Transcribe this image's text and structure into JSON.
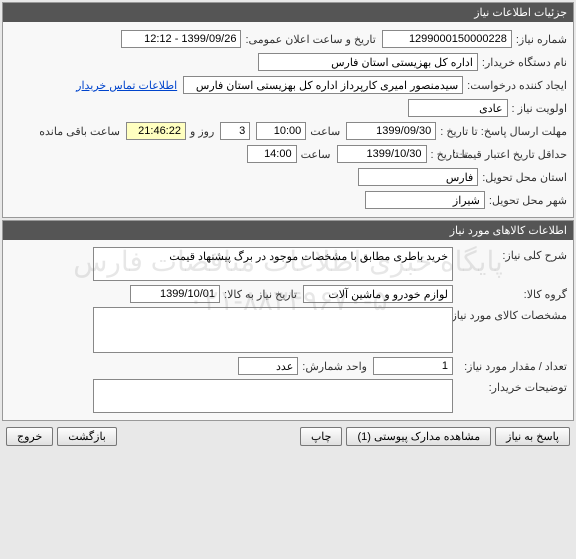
{
  "watermark": {
    "line1": "پایگاه خبری اطلاعات مناقصات فارس",
    "line2": "۰۲۱-۸۸۳۴۹۶۷۰-۵"
  },
  "panel1": {
    "title": "جزئیات اطلاعات نیاز",
    "need_number_label": "شماره نیاز:",
    "need_number": "1299000150000228",
    "announce_label": "تاریخ و ساعت اعلان عمومی:",
    "announce_value": "1399/09/26 - 12:12",
    "buyer_org_label": "نام دستگاه خریدار:",
    "buyer_org": "اداره کل بهزیستی استان فارس",
    "creator_label": "ایجاد کننده درخواست:",
    "creator": "سیدمنصور امیری کارپرداز اداره کل بهزیستی استان فارس",
    "contact_link": "اطلاعات تماس خریدار",
    "priority_label": "اولویت نیاز :",
    "priority": "عادی",
    "deadline_label": "مهلت ارسال پاسخ:  تا تاریخ :",
    "deadline_date": "1399/09/30",
    "time_label": "ساعت",
    "deadline_time": "10:00",
    "days_count": "3",
    "days_label": "روز و",
    "countdown": "21:46:22",
    "remaining_label": "ساعت باقی مانده",
    "min_validity_label": "حداقل تاریخ اعتبار قیمت:",
    "min_validity_sub": "تا تاریخ :",
    "min_validity_date": "1399/10/30",
    "min_validity_time": "14:00",
    "province_label": "استان محل تحویل:",
    "province": "فارس",
    "city_label": "شهر محل تحویل:",
    "city": "شیراز"
  },
  "panel2": {
    "title": "اطلاعات کالاهای مورد نیاز",
    "desc_label": "شرح کلی نیاز:",
    "desc": "خرید باطری مطابق با مشخصات موجود در برگ پیشنهاد قیمت",
    "group_label": "گروه کالا:",
    "group": "لوازم خودرو و ماشین آلات",
    "need_date_label": "تاریخ نیاز به کالا:",
    "need_date": "1399/10/01",
    "spec_label": "مشخصات کالای مورد نیاز:",
    "spec": "",
    "qty_label": "تعداد / مقدار مورد نیاز:",
    "qty": "1",
    "unit_label": "واحد شمارش:",
    "unit": "عدد",
    "buyer_notes_label": "توضیحات خریدار:",
    "buyer_notes": ""
  },
  "buttons": {
    "reply": "پاسخ به نیاز",
    "attachments": "مشاهده مدارک پیوستی (1)",
    "print": "چاپ",
    "back": "بازگشت",
    "exit": "خروج"
  }
}
